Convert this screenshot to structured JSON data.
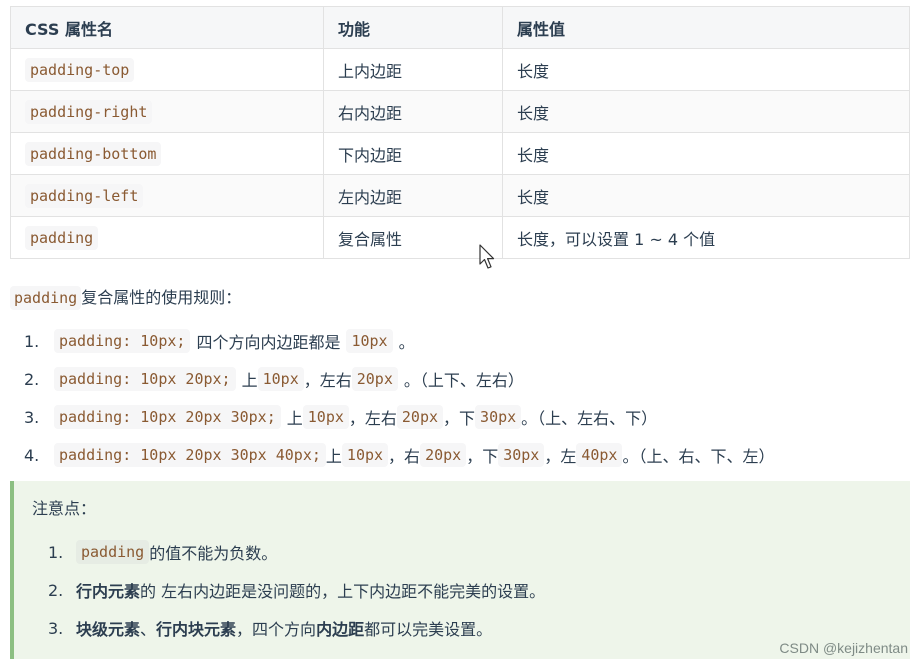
{
  "table": {
    "headers": [
      "CSS 属性名",
      "功能",
      "属性值"
    ],
    "rows": [
      [
        "padding-top",
        "上内边距",
        "长度"
      ],
      [
        "padding-right",
        "右内边距",
        "长度"
      ],
      [
        "padding-bottom",
        "下内边距",
        "长度"
      ],
      [
        "padding-left",
        "左内边距",
        "长度"
      ],
      [
        "padding",
        "复合属性",
        "长度，可以设置 1 ~ 4 个值"
      ]
    ]
  },
  "intro": {
    "code": "padding",
    "text": "复合属性的使用规则："
  },
  "rules": [
    {
      "num": "1.",
      "code": "padding: 10px;",
      "t1": "四个方向内边距都是",
      "c1": "10px",
      "t2": "。"
    },
    {
      "num": "2.",
      "code": "padding: 10px 20px;",
      "t1": "上",
      "c1": "10px",
      "t2": "，左右",
      "c2": "20px",
      "t3": "。（上下、左右）"
    },
    {
      "num": "3.",
      "code": "padding: 10px 20px 30px;",
      "t1": "上",
      "c1": "10px",
      "t2": "，左右",
      "c2": "20px",
      "t3": "，下",
      "c3": "30px",
      "t4": "。（上、左右、下）"
    },
    {
      "num": "4.",
      "code": "padding: 10px 20px 30px 40px;",
      "t1": "上",
      "c1": "10px",
      "t2": "，右",
      "c2": "20px",
      "t3": "，下",
      "c3": "30px",
      "t4": "，左",
      "c4": "40px",
      "t5": "。（上、右、下、左）"
    }
  ],
  "tip": {
    "title": "注意点：",
    "items": [
      {
        "num": "1.",
        "code": "padding",
        "text": "的值不能为负数。"
      },
      {
        "num": "2.",
        "bold1": "行内元素",
        "text": "的 左右内边距是没问题的，上下内边距不能完美的设置。"
      },
      {
        "num": "3.",
        "bold1": "块级元素",
        "sep": "、",
        "bold2": "行内块元素",
        "text1": "，四个方向",
        "bold3": "内边距",
        "text2": "都可以完美设置。"
      }
    ]
  },
  "watermark": "CSDN @kejizhentan",
  "colors": {
    "code_text": "#8a5a32",
    "tip_bg": "#eef5ea",
    "tip_border": "#8cbf82"
  }
}
